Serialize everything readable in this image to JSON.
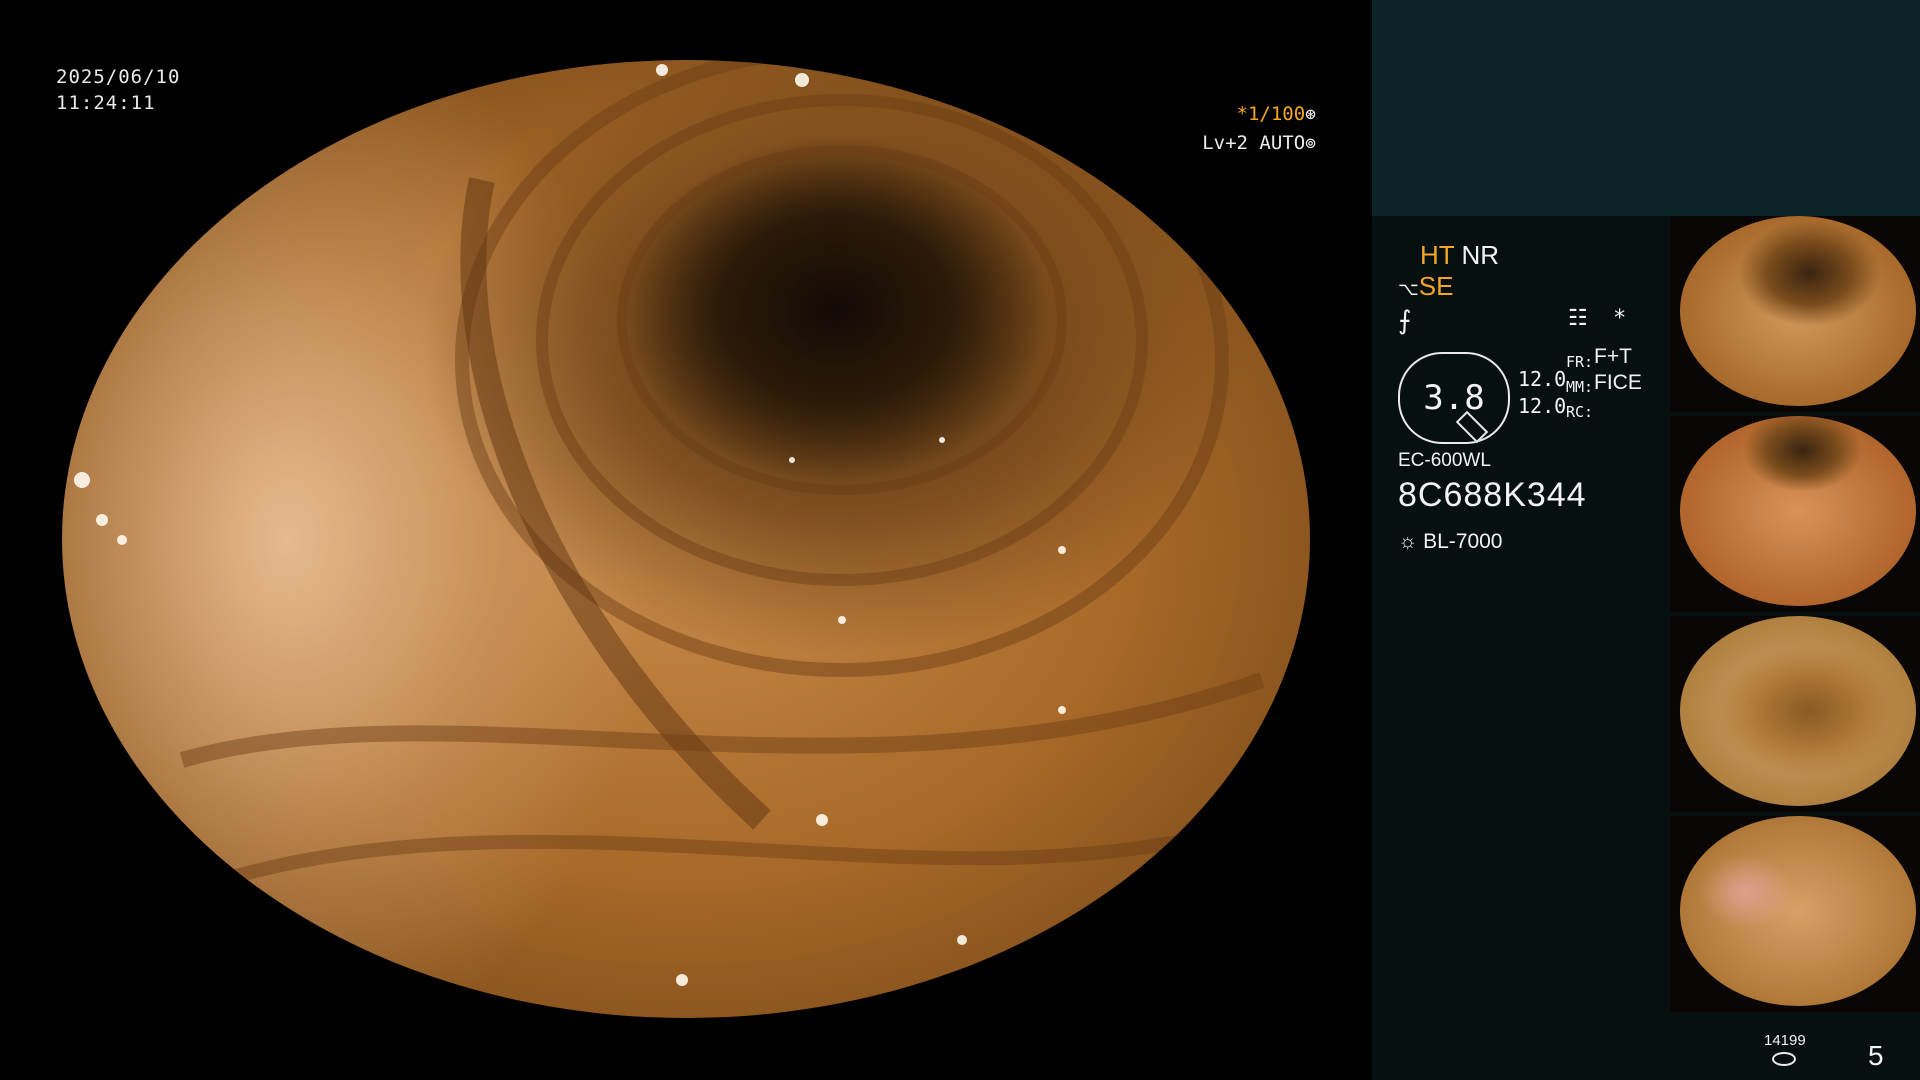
{
  "overlay": {
    "date": "2025/06/10",
    "time": "11:24:11",
    "shutter": "*1/100",
    "level_mode": "Lv+2 AUTO"
  },
  "status": {
    "ht": "HT",
    "nr": "NR",
    "se": "SE",
    "zoom": "3.8",
    "value_1": "12.0",
    "value_2": "12.0",
    "fr_label": "FR:",
    "mm_label": "MM:",
    "rc_label": "RC:",
    "fr_value": "F+T",
    "mm_value": "FICE",
    "scope_model": "EC-600WL",
    "scope_serial": "8C688K344",
    "light_source": "BL-7000",
    "asterisk": "*"
  },
  "footer": {
    "storage_count": "14199",
    "page_number": "5"
  },
  "colors": {
    "accent": "#f5a623",
    "panel": "#071010",
    "panel_top": "#0b2426",
    "text": "#f2f2f2"
  },
  "icons": [
    "shutter-icon",
    "auto-icon",
    "se-mode-icon",
    "toggle-icon",
    "settings-icon",
    "light-source-icon",
    "storage-icon"
  ]
}
